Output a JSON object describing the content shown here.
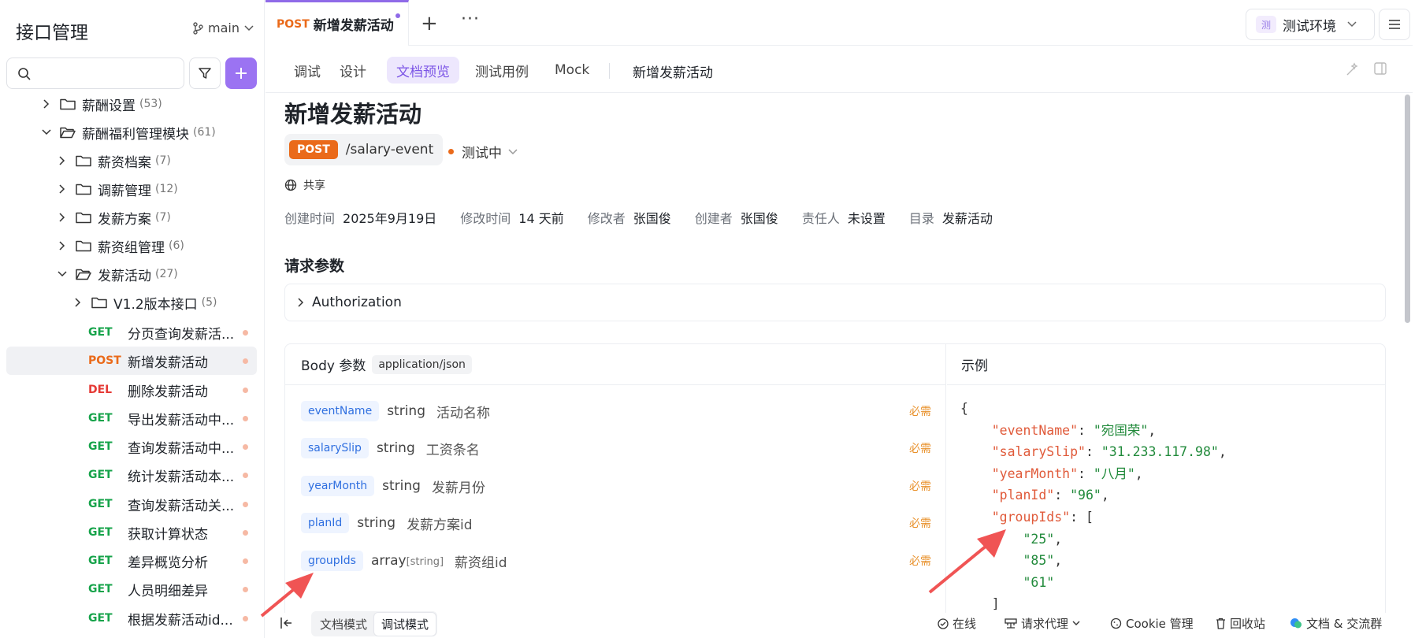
{
  "sidebar": {
    "title": "接口管理",
    "branch": "main",
    "search_placeholder": "",
    "tree": [
      {
        "label": "薪酬设置",
        "count": "(53)"
      },
      {
        "label": "薪酬福利管理模块",
        "count": "(61)"
      },
      {
        "label": "薪资档案",
        "count": "(7)"
      },
      {
        "label": "调薪管理",
        "count": "(12)"
      },
      {
        "label": "发薪方案",
        "count": "(7)"
      },
      {
        "label": "薪资组管理",
        "count": "(6)"
      },
      {
        "label": "发薪活动",
        "count": "(27)"
      },
      {
        "label": "V1.2版本接口",
        "count": "(5)"
      }
    ],
    "apis": [
      {
        "method": "GET",
        "label": "分页查询发薪活..."
      },
      {
        "method": "POST",
        "label": "新增发薪活动"
      },
      {
        "method": "DEL",
        "label": "删除发薪活动"
      },
      {
        "method": "GET",
        "label": "导出发薪活动中..."
      },
      {
        "method": "GET",
        "label": "查询发薪活动中..."
      },
      {
        "method": "GET",
        "label": "统计发薪活动本..."
      },
      {
        "method": "GET",
        "label": "查询发薪活动关..."
      },
      {
        "method": "GET",
        "label": "获取计算状态"
      },
      {
        "method": "GET",
        "label": "差异概览分析"
      },
      {
        "method": "GET",
        "label": "人员明细差异"
      },
      {
        "method": "GET",
        "label": "根据发薪活动id..."
      }
    ]
  },
  "tabbar": {
    "active_method": "POST",
    "active_title": "新增发薪活动",
    "plus": "+",
    "more": "···",
    "env_badge": "测",
    "env_label": "测试环境"
  },
  "subtabs": {
    "items": [
      "调试",
      "设计",
      "文档预览",
      "测试用例",
      "Mock"
    ],
    "title": "新增发薪活动"
  },
  "doc": {
    "title": "新增发薪活动",
    "method": "POST",
    "path": "/salary-event",
    "status": "测试中",
    "share": "共享",
    "meta": [
      {
        "k": "创建时间",
        "v": "2025年9月19日"
      },
      {
        "k": "修改时间",
        "v": "14 天前"
      },
      {
        "k": "修改者",
        "v": "张国俊"
      },
      {
        "k": "创建者",
        "v": "张国俊"
      },
      {
        "k": "责任人",
        "v": "未设置"
      },
      {
        "k": "目录",
        "v": "发薪活动"
      }
    ],
    "request_title": "请求参数",
    "auth_label": "Authorization",
    "body_label": "Body 参数",
    "content_type": "application/json",
    "example_label": "示例",
    "params": [
      {
        "name": "eventName",
        "type": "string",
        "sub": "",
        "desc": "活动名称",
        "req": "必需"
      },
      {
        "name": "salarySlip",
        "type": "string",
        "sub": "",
        "desc": "工资条名",
        "req": "必需"
      },
      {
        "name": "yearMonth",
        "type": "string",
        "sub": "",
        "desc": "发薪月份",
        "req": "必需"
      },
      {
        "name": "planId",
        "type": "string",
        "sub": "",
        "desc": "发薪方案id",
        "req": "必需"
      },
      {
        "name": "groupIds",
        "type": "array",
        "sub": "[string]",
        "desc": "薪资组id",
        "req": "必需"
      }
    ],
    "example": {
      "eventName": "宛国荣",
      "salarySlip": "31.233.117.98",
      "yearMonth": "八月",
      "planId": "96",
      "groupIds": [
        "25",
        "85",
        "61"
      ]
    }
  },
  "bottombar": {
    "modes": [
      "文档模式",
      "调试模式"
    ],
    "online": "在线",
    "proxy": "请求代理",
    "cookie": "Cookie 管理",
    "recycle": "回收站",
    "docs": "文档 & 交流群"
  }
}
